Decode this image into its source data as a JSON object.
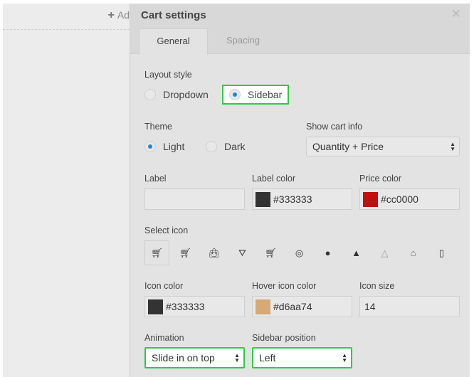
{
  "background": {
    "add_label": "Ad"
  },
  "panel": {
    "title": "Cart settings",
    "close_icon": "close-icon",
    "tabs": [
      {
        "label": "General",
        "active": true
      },
      {
        "label": "Spacing",
        "active": false
      }
    ]
  },
  "layout_style": {
    "label": "Layout style",
    "options": [
      "Dropdown",
      "Sidebar"
    ],
    "selected": "Sidebar"
  },
  "theme": {
    "label": "Theme",
    "options": [
      "Light",
      "Dark"
    ],
    "selected": "Light"
  },
  "show_cart_info": {
    "label": "Show cart info",
    "value": "Quantity + Price"
  },
  "label_field": {
    "label": "Label",
    "value": ""
  },
  "label_color": {
    "label": "Label color",
    "value": "#333333"
  },
  "price_color": {
    "label": "Price color",
    "value": "#cc0000"
  },
  "select_icon": {
    "label": "Select icon",
    "icons": [
      "cart-icon",
      "cart-plus-icon",
      "bag-icon",
      "basket-icon",
      "trolley-icon",
      "circle-cart-outline-icon",
      "circle-cart-filled-icon",
      "bag-filled-icon",
      "bag-light-icon",
      "bag-outline-icon",
      "clipboard-bag-icon"
    ],
    "selected": 0
  },
  "icon_color": {
    "label": "Icon color",
    "value": "#333333"
  },
  "hover_icon_color": {
    "label": "Hover icon color",
    "value": "#d6aa74"
  },
  "icon_size": {
    "label": "Icon size",
    "value": "14"
  },
  "animation": {
    "label": "Animation",
    "value": "Slide in on top"
  },
  "sidebar_position": {
    "label": "Sidebar position",
    "value": "Left"
  },
  "colors": {
    "highlight": "#2ecc40",
    "radio_on": "#1e88d0"
  }
}
